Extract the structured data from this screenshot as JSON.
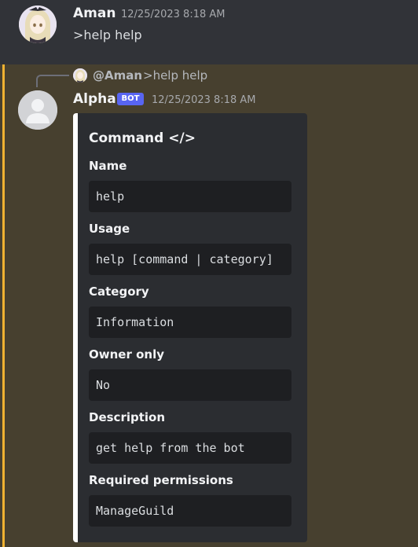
{
  "message_1": {
    "author": "Aman",
    "timestamp": "12/25/2023 8:18 AM",
    "content": ">help help"
  },
  "reply_preview": {
    "mention": "@Aman",
    "content": ">help help"
  },
  "message_2": {
    "author": "Alpha",
    "bot_tag": "BOT",
    "timestamp": "12/25/2023 8:18 AM"
  },
  "embed": {
    "title": "Command </>",
    "fields": [
      {
        "name": "Name",
        "value": "help"
      },
      {
        "name": "Usage",
        "value": "help [command | category]"
      },
      {
        "name": "Category",
        "value": "Information"
      },
      {
        "name": "Owner only",
        "value": "No"
      },
      {
        "name": "Description",
        "value": "get help from the bot"
      },
      {
        "name": "Required permissions",
        "value": "ManageGuild"
      }
    ]
  },
  "icons": {
    "aman_avatar": "anime-girl-avatar-icon",
    "alpha_avatar": "default-user-avatar-icon"
  },
  "colors": {
    "mention_highlight": "#f0b232",
    "bot_tag": "#5865f2",
    "embed_accent": "#ffffff"
  }
}
